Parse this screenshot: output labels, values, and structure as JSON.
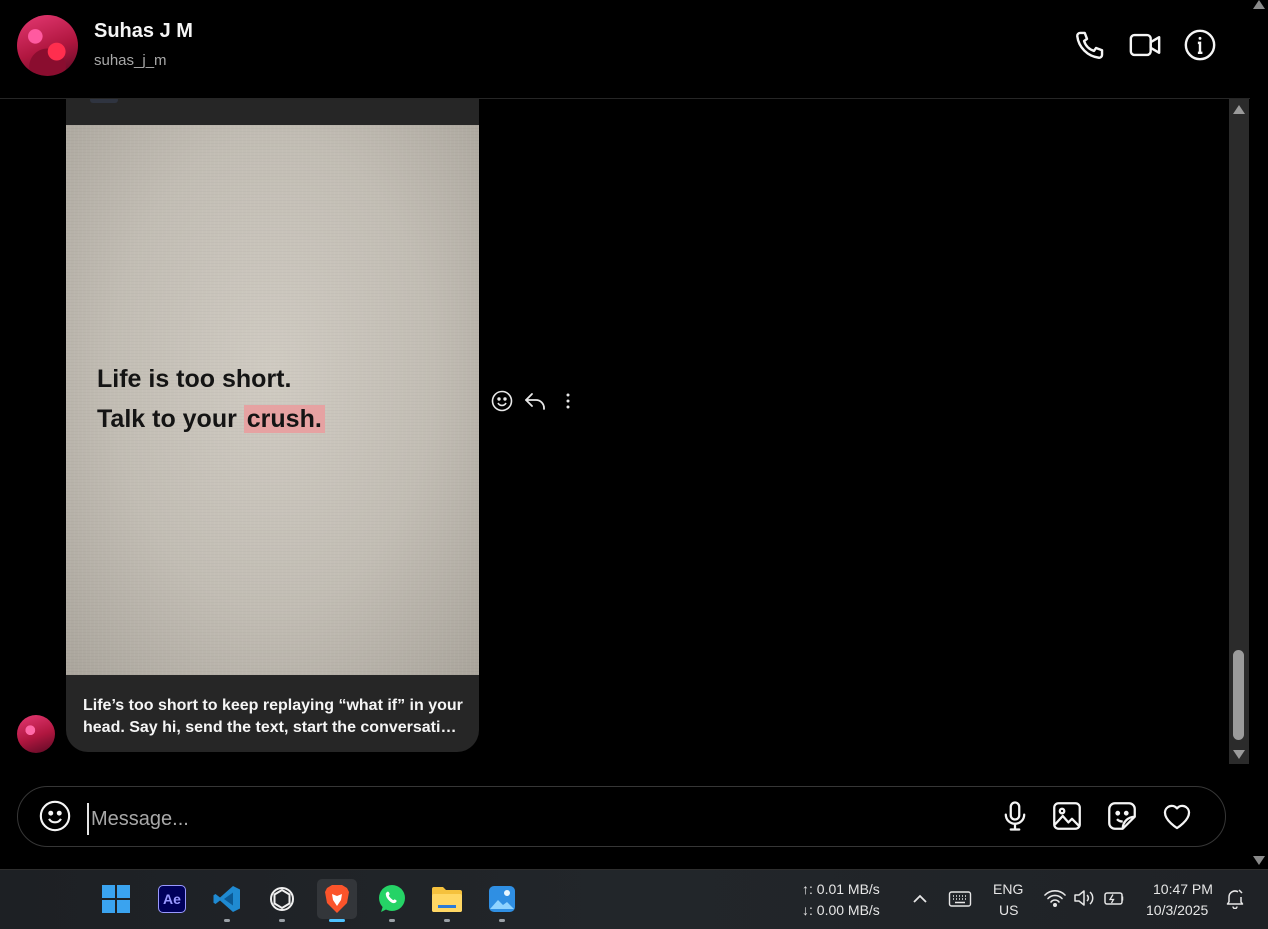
{
  "header": {
    "name": "Suhas J M",
    "handle": "suhas_j_m",
    "icons": [
      "phone-icon",
      "video-call-icon",
      "info-icon"
    ]
  },
  "post": {
    "quote_line1": "Life is too short.",
    "quote_line2_prefix": "Talk to your ",
    "quote_line2_highlight": "crush.",
    "highlight_color": "#e6a2a2",
    "caption_line1": "Life’s too short to keep replaying “what if” in your",
    "caption_line2": "head. Say hi, send the text, start the conversatio..."
  },
  "message_actions": [
    "emoji-react-icon",
    "reply-icon",
    "more-options-icon"
  ],
  "composer": {
    "placeholder": "Message...",
    "icons": [
      "emoji-icon",
      "microphone-icon",
      "gallery-icon",
      "sticker-icon",
      "heart-icon"
    ]
  },
  "taskbar": {
    "apps": [
      "Start",
      "Adobe After Effects",
      "Visual Studio Code",
      "ChatGPT",
      "Brave",
      "WhatsApp",
      "File Explorer",
      "Photos"
    ],
    "ae_label": "Ae",
    "net_up": "↑: 0.01 MB/s",
    "net_down": "↓: 0.00 MB/s",
    "lang": "ENG",
    "region": "US",
    "time": "10:47 PM",
    "date": "10/3/2025"
  },
  "colors": {
    "background": "#000000",
    "bubble": "#262626",
    "text_primary": "#f5f5f5",
    "text_secondary": "#a8a8a8",
    "taskbar_accent": "#4cc2ff"
  }
}
